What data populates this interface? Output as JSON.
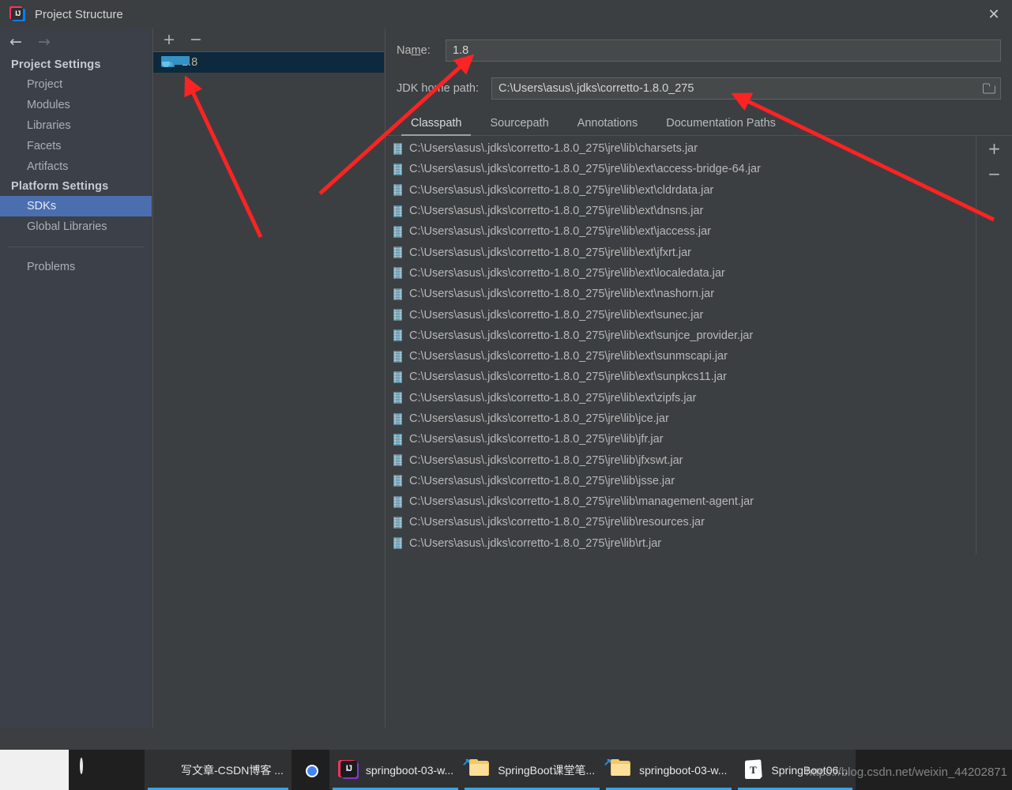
{
  "window": {
    "title": "Project Structure",
    "app_icon": "intellij-idea-icon",
    "close_label": "✕",
    "back_label": "←",
    "forward_label": "→"
  },
  "sidebar": {
    "groups": [
      {
        "title": "Project Settings",
        "items": [
          {
            "label": "Project",
            "selected": false
          },
          {
            "label": "Modules",
            "selected": false
          },
          {
            "label": "Libraries",
            "selected": false
          },
          {
            "label": "Facets",
            "selected": false
          },
          {
            "label": "Artifacts",
            "selected": false
          }
        ]
      },
      {
        "title": "Platform Settings",
        "items": [
          {
            "label": "SDKs",
            "selected": true
          },
          {
            "label": "Global Libraries",
            "selected": false
          }
        ]
      }
    ],
    "extra": [
      {
        "label": "Problems",
        "selected": false
      }
    ]
  },
  "sdk_list": {
    "add_label": "+",
    "remove_label": "−",
    "items": [
      {
        "label": "1.8",
        "icon": "jdk-folder-icon",
        "selected": true
      }
    ]
  },
  "detail": {
    "name_label": "Name:",
    "name_value": "1.8",
    "path_label": "JDK home path:",
    "path_value": "C:\\Users\\asus\\.jdks\\corretto-1.8.0_275",
    "browse_icon": "folder-browse-icon",
    "tabs": [
      {
        "label": "Classpath",
        "active": true
      },
      {
        "label": "Sourcepath",
        "active": false
      },
      {
        "label": "Annotations",
        "active": false
      },
      {
        "label": "Documentation Paths",
        "active": false
      }
    ],
    "side_add_label": "+",
    "side_remove_label": "−",
    "classpath": [
      "C:\\Users\\asus\\.jdks\\corretto-1.8.0_275\\jre\\lib\\charsets.jar",
      "C:\\Users\\asus\\.jdks\\corretto-1.8.0_275\\jre\\lib\\ext\\access-bridge-64.jar",
      "C:\\Users\\asus\\.jdks\\corretto-1.8.0_275\\jre\\lib\\ext\\cldrdata.jar",
      "C:\\Users\\asus\\.jdks\\corretto-1.8.0_275\\jre\\lib\\ext\\dnsns.jar",
      "C:\\Users\\asus\\.jdks\\corretto-1.8.0_275\\jre\\lib\\ext\\jaccess.jar",
      "C:\\Users\\asus\\.jdks\\corretto-1.8.0_275\\jre\\lib\\ext\\jfxrt.jar",
      "C:\\Users\\asus\\.jdks\\corretto-1.8.0_275\\jre\\lib\\ext\\localedata.jar",
      "C:\\Users\\asus\\.jdks\\corretto-1.8.0_275\\jre\\lib\\ext\\nashorn.jar",
      "C:\\Users\\asus\\.jdks\\corretto-1.8.0_275\\jre\\lib\\ext\\sunec.jar",
      "C:\\Users\\asus\\.jdks\\corretto-1.8.0_275\\jre\\lib\\ext\\sunjce_provider.jar",
      "C:\\Users\\asus\\.jdks\\corretto-1.8.0_275\\jre\\lib\\ext\\sunmscapi.jar",
      "C:\\Users\\asus\\.jdks\\corretto-1.8.0_275\\jre\\lib\\ext\\sunpkcs11.jar",
      "C:\\Users\\asus\\.jdks\\corretto-1.8.0_275\\jre\\lib\\ext\\zipfs.jar",
      "C:\\Users\\asus\\.jdks\\corretto-1.8.0_275\\jre\\lib\\jce.jar",
      "C:\\Users\\asus\\.jdks\\corretto-1.8.0_275\\jre\\lib\\jfr.jar",
      "C:\\Users\\asus\\.jdks\\corretto-1.8.0_275\\jre\\lib\\jfxswt.jar",
      "C:\\Users\\asus\\.jdks\\corretto-1.8.0_275\\jre\\lib\\jsse.jar",
      "C:\\Users\\asus\\.jdks\\corretto-1.8.0_275\\jre\\lib\\management-agent.jar",
      "C:\\Users\\asus\\.jdks\\corretto-1.8.0_275\\jre\\lib\\resources.jar",
      "C:\\Users\\asus\\.jdks\\corretto-1.8.0_275\\jre\\lib\\rt.jar"
    ]
  },
  "annotations": {
    "arrow_color": "#fb2323",
    "count": 3
  },
  "taskbar": {
    "buttons": [
      {
        "label": "",
        "icon": "cortana-circle-icon",
        "active": false
      },
      {
        "label": "",
        "icon": "task-view-icon",
        "active": false
      },
      {
        "label": "写文章-CSDN博客 ...",
        "icon": "firefox-icon",
        "active": true
      },
      {
        "label": "",
        "icon": "chrome-icon",
        "active": false
      },
      {
        "label": "springboot-03-w...",
        "icon": "intellij-idea-icon",
        "active": true
      },
      {
        "label": "SpringBoot课堂笔...",
        "icon": "folder-icon",
        "active": true
      },
      {
        "label": "springboot-03-w...",
        "icon": "folder-icon",
        "active": true
      },
      {
        "label": "SpringBoot06...",
        "icon": "text-file-icon",
        "active": true
      }
    ]
  },
  "watermark": {
    "text": "https://blog.csdn.net/weixin_44202871"
  },
  "colors": {
    "dialog_bg": "#3c3f41",
    "sidebar_bg": "#3c4049",
    "selection_blue": "#4b6eaf",
    "row_selection": "#0d293e",
    "accent_red": "#fb2323",
    "text": "#b8b8b8"
  }
}
